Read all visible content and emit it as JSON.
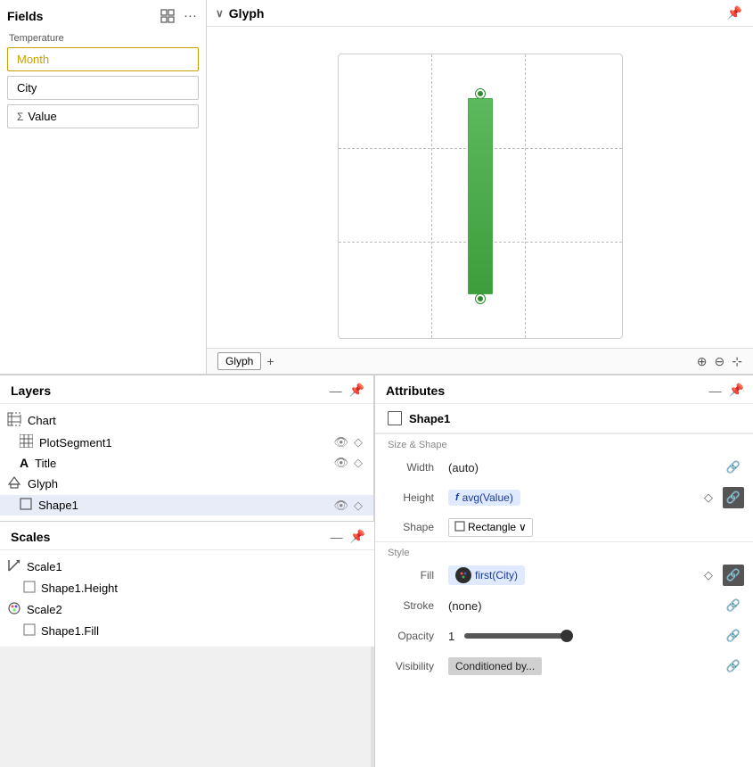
{
  "fields": {
    "title": "Fields",
    "group_label": "Temperature",
    "items": [
      {
        "id": "month",
        "label": "Month",
        "type": "text",
        "active": true
      },
      {
        "id": "city",
        "label": "City",
        "type": "text",
        "active": false
      },
      {
        "id": "value",
        "label": "Value",
        "type": "measure",
        "active": false
      }
    ]
  },
  "glyph": {
    "title": "Glyph",
    "tab_label": "Glyph",
    "plus_label": "+",
    "zoom_in": "⊕",
    "zoom_out": "⊖",
    "reset": "⊕"
  },
  "layers": {
    "title": "Layers",
    "items": [
      {
        "id": "chart",
        "label": "Chart",
        "icon": "chart-icon",
        "indent": 0
      },
      {
        "id": "plotsegment1",
        "label": "PlotSegment1",
        "icon": "grid-icon",
        "indent": 1,
        "has_actions": true
      },
      {
        "id": "title",
        "label": "Title",
        "icon": "text-icon",
        "indent": 1,
        "has_actions": true
      },
      {
        "id": "glyph",
        "label": "Glyph",
        "icon": "glyph-icon",
        "indent": 0
      },
      {
        "id": "shape1",
        "label": "Shape1",
        "icon": "rect-icon",
        "indent": 1,
        "has_actions": true,
        "selected": true
      }
    ]
  },
  "scales": {
    "title": "Scales",
    "items": [
      {
        "id": "scale1",
        "label": "Scale1",
        "icon": "scale-arrow-icon",
        "indent": 0
      },
      {
        "id": "shape1height",
        "label": "Shape1.Height",
        "icon": "rect-icon",
        "indent": 1
      },
      {
        "id": "scale2",
        "label": "Scale2",
        "icon": "palette-icon",
        "indent": 0
      },
      {
        "id": "shape1fill",
        "label": "Shape1.Fill",
        "icon": "rect-icon",
        "indent": 1
      }
    ]
  },
  "attributes": {
    "title": "Attributes",
    "shape_name": "Shape1",
    "size_shape_label": "Size & Shape",
    "style_label": "Style",
    "rows": [
      {
        "id": "width",
        "label": "Width",
        "value_type": "auto",
        "value_text": "(auto)"
      },
      {
        "id": "height",
        "label": "Height",
        "value_type": "func",
        "func_label": "f",
        "value_text": "avg(Value)"
      },
      {
        "id": "shape",
        "label": "Shape",
        "value_type": "select",
        "value_text": "Rectangle"
      },
      {
        "id": "fill",
        "label": "Fill",
        "value_type": "func_color",
        "value_text": "first(City)"
      },
      {
        "id": "stroke",
        "label": "Stroke",
        "value_type": "text",
        "value_text": "(none)"
      },
      {
        "id": "opacity",
        "label": "Opacity",
        "value_type": "slider",
        "value_text": "1",
        "slider_pct": 100
      },
      {
        "id": "visibility",
        "label": "Visibility",
        "value_type": "cond",
        "value_text": "Conditioned by..."
      }
    ]
  }
}
